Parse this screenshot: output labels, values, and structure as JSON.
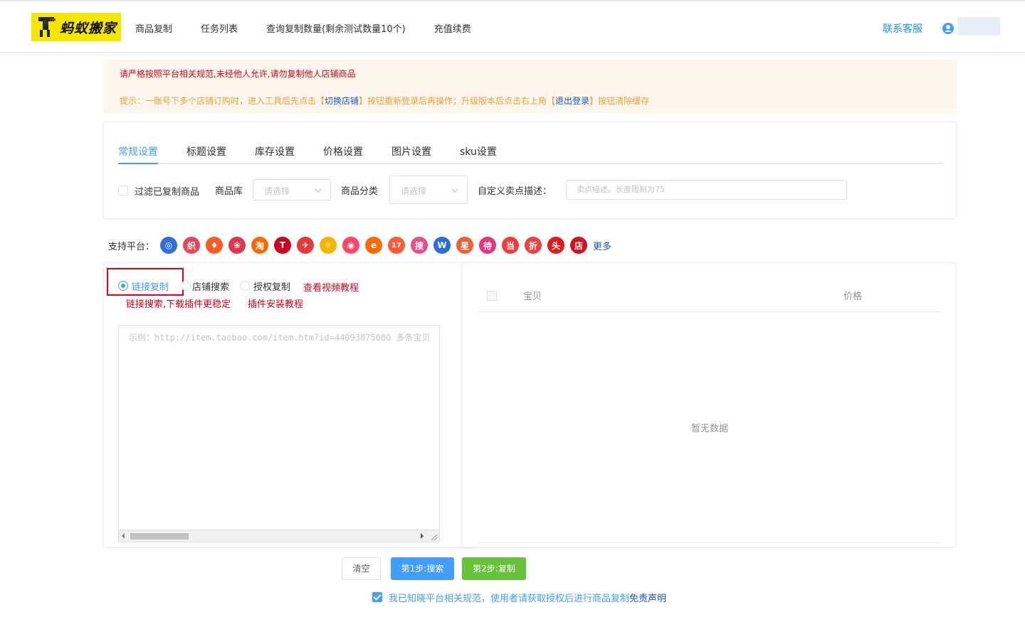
{
  "header": {
    "logo_text": "蚂蚁搬家",
    "nav": [
      "商品复制",
      "任务列表",
      "查询复制数量(剩余测试数量10个)",
      "充值续费"
    ],
    "contact": "联系客服"
  },
  "notice": {
    "warning": "请严格按照平台相关规范,未经他人允许,请勿复制他人店铺商品",
    "tip_prefix": "提示：一账号下多个店铺订购时，进入工具后先点击【",
    "tip_switch": "切换店铺",
    "tip_middle": "】按钮重新登录后再操作；升级版本后点击右上角【",
    "tip_logout": "退出登录",
    "tip_suffix": "】按钮清除缓存"
  },
  "settings": {
    "tabs": [
      "常规设置",
      "标题设置",
      "库存设置",
      "价格设置",
      "图片设置",
      "sku设置"
    ],
    "active_tab": "常规设置",
    "filter_copied": "过滤已复制商品",
    "library_label": "商品库",
    "library_placeholder": "请选择",
    "category_label": "商品分类",
    "category_placeholder": "请选择",
    "custom_desc_label": "自定义卖点描述：",
    "custom_desc_placeholder": "卖点描述。长度限制为75"
  },
  "platforms": {
    "label": "支持平台：",
    "icons": [
      {
        "name": "1688-icon",
        "glyph": "◎",
        "color": "#2f6de1"
      },
      {
        "name": "zhi-icon",
        "glyph": "织",
        "color": "#e8445a"
      },
      {
        "name": "flame-icon",
        "glyph": "♦",
        "color": "#ff5a1f"
      },
      {
        "name": "vip-icon",
        "glyph": "❀",
        "color": "#e5334b"
      },
      {
        "name": "taobao-icon",
        "glyph": "淘",
        "color": "#ff6a00"
      },
      {
        "name": "tmall-icon",
        "glyph": "T",
        "color": "#d0021b"
      },
      {
        "name": "juanpi-icon",
        "glyph": "✈",
        "color": "#e4393c"
      },
      {
        "name": "lion-icon",
        "glyph": "☼",
        "color": "#f7b500"
      },
      {
        "name": "mogujie-icon",
        "glyph": "◉",
        "color": "#ff4466"
      },
      {
        "name": "aliexpress-icon",
        "glyph": "e",
        "color": "#ff6a00"
      },
      {
        "name": "num17-icon",
        "glyph": "17",
        "color": "#ff5a36"
      },
      {
        "name": "sou-icon",
        "glyph": "搜",
        "color": "#e94b8c"
      },
      {
        "name": "w-icon",
        "glyph": "W",
        "color": "#2a6be0"
      },
      {
        "name": "xing-icon",
        "glyph": "星",
        "color": "#f06030"
      },
      {
        "name": "dai-icon",
        "glyph": "待",
        "color": "#e8337a"
      },
      {
        "name": "dang-icon",
        "glyph": "当",
        "color": "#f03c3c"
      },
      {
        "name": "zhe-icon",
        "glyph": "折",
        "color": "#f04040"
      },
      {
        "name": "tou-icon",
        "glyph": "头",
        "color": "#e21a1a"
      },
      {
        "name": "dian-icon",
        "glyph": "店",
        "color": "#d4121e"
      }
    ],
    "more": "更多"
  },
  "copy_panel": {
    "mode_link": "链接复制",
    "mode_shop": "店铺搜索",
    "mode_auth": "授权复制",
    "video_tutorial": "查看视频教程",
    "plugin_tip": "链接搜索,下载插件更稳定",
    "plugin_install": "插件安装教程",
    "textarea_placeholder": "示例：http://item.taobao.com/item.htm?id=44093875000   多条宝贝"
  },
  "result_table": {
    "col_item": "宝贝",
    "col_price": "价格",
    "empty_text": "暂无数据"
  },
  "actions": {
    "clear": "清空",
    "step1": "第1步:搜索",
    "step2": "第2步:复制"
  },
  "agreement": {
    "text": "我已知晓平台相关规范，使用者请获取授权后进行商品复制",
    "disclaimer": "免责声明"
  }
}
